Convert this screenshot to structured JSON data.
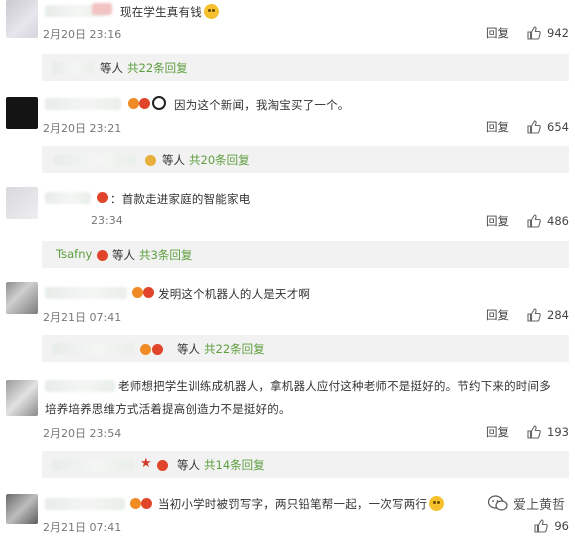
{
  "comments": [
    {
      "text": "现在学生真有钱",
      "time": "2月20日 23:16",
      "reply": "回复",
      "likes": "942",
      "sub": {
        "label": "等人",
        "count": "共22条回复"
      }
    },
    {
      "text": "因为这个新闻，我淘宝买了一个。",
      "time": "2月20日 23:21",
      "reply": "回复",
      "likes": "654",
      "sub": {
        "label": "等人",
        "count": "共20条回复"
      }
    },
    {
      "text": "：首款走进家庭的智能家电",
      "time": "23:34",
      "reply": "回复",
      "likes": "486",
      "sub": {
        "name": "Tsafny",
        "label": "等人",
        "count": "共3条回复"
      }
    },
    {
      "text": "发明这个机器人的人是天才啊",
      "time": "2月21日 07:41",
      "reply": "回复",
      "likes": "284",
      "sub": {
        "label": "等人",
        "count": "共22条回复"
      }
    },
    {
      "text_line1": "老师想把学生训练成机器人，拿机器人应付这种老师不是挺好的。节约下来的时间多",
      "text_line2": "培养培养思维方式活着提高创造力不是挺好的。",
      "time": "2月20日 23:54",
      "reply": "回复",
      "likes": "193",
      "sub": {
        "label": "等人",
        "count": "共14条回复"
      }
    },
    {
      "text": "当初小学时被罚写字，两只铅笔帮一起，一次写两行",
      "time": "2月21日 07:41",
      "reply": "回复",
      "likes": "96"
    }
  ],
  "watermark": "爱上黄哲",
  "colors": {
    "link_green": "#5c9e3e",
    "sub_bg": "#f2f2f2",
    "badge_orange": "#f08a24",
    "badge_red": "#e0452b"
  },
  "icons": [
    "thumbs-up-icon",
    "vip-badge-icon",
    "panda-emoji-icon",
    "laugh-emoji-icon",
    "wechat-logo-icon"
  ]
}
